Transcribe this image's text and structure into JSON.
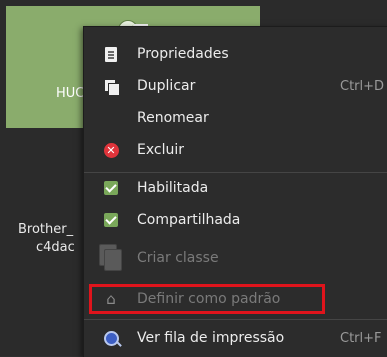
{
  "background": {
    "selected_printer_label": "HUC",
    "second_printer_line1": "Brother_",
    "second_printer_line2": "c4dac"
  },
  "context_menu": {
    "items": [
      {
        "label": "Propriedades",
        "icon": "properties-icon"
      },
      {
        "label": "Duplicar",
        "icon": "duplicate-icon",
        "shortcut": "Ctrl+D"
      },
      {
        "label": "Renomear"
      },
      {
        "label": "Excluir",
        "icon": "delete-icon"
      },
      {
        "label": "Habilitada",
        "icon": "checkbox-checked-icon",
        "checked": true
      },
      {
        "label": "Compartilhada",
        "icon": "checkbox-checked-icon",
        "checked": true
      },
      {
        "label": "Criar classe",
        "icon": "printer-class-icon",
        "disabled": true
      },
      {
        "label": "Definir como padrão",
        "icon": "home-icon",
        "disabled": true
      },
      {
        "label": "Ver fila de impressão",
        "icon": "print-queue-icon",
        "shortcut": "Ctrl+F"
      }
    ]
  },
  "colors": {
    "selected_tile": "#8aac6c",
    "highlight_border": "#e0141c",
    "menu_background": "#2c2c2c"
  }
}
